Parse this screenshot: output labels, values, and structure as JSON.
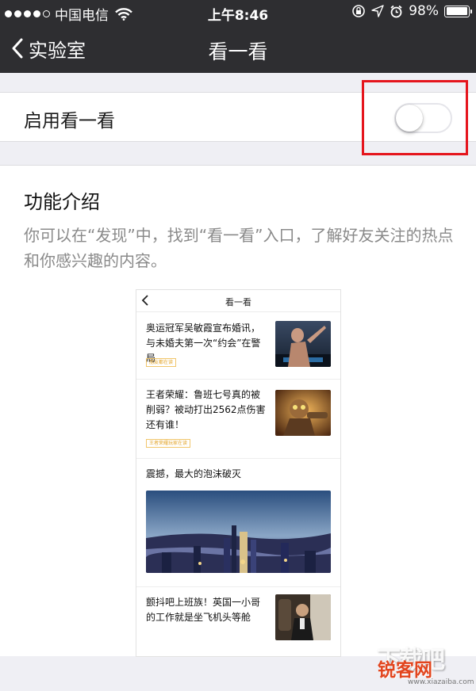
{
  "status_bar": {
    "carrier": "中国电信",
    "time": "上午8:46",
    "battery": "98%",
    "battery_level": 0.98,
    "signal_bars": 4,
    "icons": [
      "wifi-icon",
      "rotation-lock-icon",
      "location-icon",
      "alarm-icon",
      "battery-icon"
    ]
  },
  "nav": {
    "back_label": "实验室",
    "title": "看一看"
  },
  "setting": {
    "label": "启用看一看",
    "enabled": false
  },
  "intro": {
    "title": "功能介绍",
    "description": "你可以在“发现”中，找到“看一看”入口，了解好友关注的热点和你感兴趣的内容。"
  },
  "preview": {
    "title": "看一看",
    "items": [
      {
        "text": "奥运冠军吴敏霞宣布婚讯，与未婚夫第一次“约会”在警局",
        "tag": "朋友都在读"
      },
      {
        "text": "王者荣耀：鲁班七号真的被削弱？被动打出2562点伤害还有谁！",
        "tag": "王者荣耀玩家在读"
      },
      {
        "text": "震撼，最大的泡沫破灭"
      },
      {
        "text": "颤抖吧上班族！英国一小哥的工作就是坐飞机头等舱"
      }
    ]
  },
  "watermark": {
    "line1": "下载吧",
    "line2": "锐客网",
    "line3": "www.xiazaiba.com"
  },
  "colors": {
    "nav_background": "#2e2e31",
    "page_background": "#efeff4",
    "highlight_box": "#e5151d",
    "secondary_text": "#8a8a8a",
    "tag": "#e3a52b"
  }
}
